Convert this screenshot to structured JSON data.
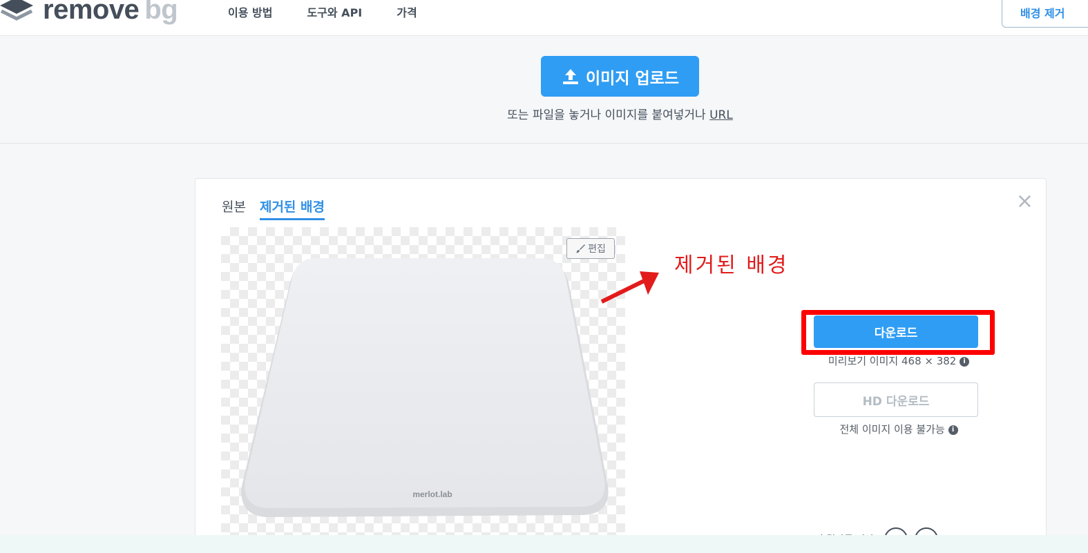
{
  "header": {
    "logo": {
      "part1": "remove",
      "part2": "bg"
    },
    "nav": [
      "이용 방법",
      "도구와 API",
      "가격"
    ],
    "cta_label": "배경 제거"
  },
  "upload": {
    "button_label": "이미지 업로드",
    "hint_text": "또는 파일을 놓거나 이미지를 붙여넣거나",
    "url_label": "URL"
  },
  "result": {
    "tabs": [
      {
        "label": "원본",
        "active": false
      },
      {
        "label": "제거된 배경",
        "active": true
      }
    ],
    "close_symbol": "×",
    "edit_label": "편집",
    "product_text": "merlot.lab",
    "annotation": "제거된 배경",
    "download_label": "다운로드",
    "preview_info": "미리보기 이미지 468 × 382",
    "hd_download_label": "HD 다운로드",
    "full_info": "전체 이미지 이용 불가능",
    "rating_label": "이 결과를 평가:"
  },
  "colors": {
    "accent": "#2f9df4",
    "annotation_red": "#e21b1b",
    "highlight_red": "#ff0000"
  },
  "icons": [
    "logo-layers-icon",
    "upload-icon",
    "brush-icon",
    "info-icon",
    "close-icon",
    "smile-face-icon",
    "frown-face-icon"
  ]
}
